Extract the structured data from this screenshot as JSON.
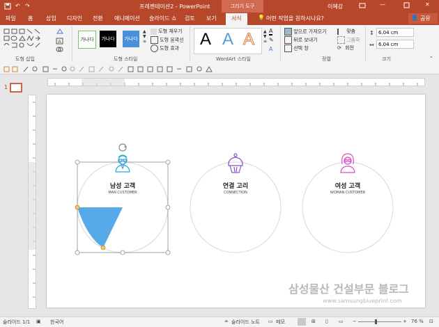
{
  "titlebar": {
    "title": "프레젠테이션2 - PowerPoint",
    "context_tool": "그리기 도구",
    "user_name": "이혜강"
  },
  "tabs": [
    "파일",
    "홈",
    "삽입",
    "디자인",
    "전환",
    "애니메이션",
    "슬라이드 쇼",
    "검토",
    "보기",
    "서식"
  ],
  "tell_me": "어떤 작업을 원하시나요?",
  "share": "공유",
  "ribbon": {
    "insert_shapes": "도형 삽입",
    "shape_styles": "도형 스타일",
    "quick_styles": [
      "가나다",
      "가나다",
      "가나다"
    ],
    "shape_fill": "도형 채우기",
    "shape_outline": "도형 윤곽선",
    "shape_effects": "도형 효과",
    "wordart": "WordArt 스타일",
    "wordart_letter": "A",
    "arrange": "정렬",
    "bring_forward": "앞으로 가져오기",
    "send_backward": "뒤로 보내기",
    "selection_pane": "선택 창",
    "align": "맞춤",
    "group": "그룹화",
    "rotate": "회전",
    "size": "크기",
    "height": "6.04 cm",
    "width": "6.04 cm"
  },
  "slide_thumb_number": "1",
  "slide": {
    "items": [
      {
        "title": "남성 고객",
        "subtitle": "MAN CUSTOMER"
      },
      {
        "title": "연결 고리",
        "subtitle": "CONNECTION"
      },
      {
        "title": "여성 고객",
        "subtitle": "WOMAN CUSTOMER"
      }
    ]
  },
  "status": {
    "slide_info": "슬라이드 1/1",
    "language": "한국어",
    "notes": "슬라이드 노트",
    "comments": "메모",
    "zoom": "76 %"
  },
  "watermark": {
    "title": "삼성물산 건설부문 블로그",
    "url": "www.samsungblueprint.com"
  },
  "colors": {
    "accent": "#b7472a",
    "wedge": "#56a9e8",
    "man_icon": "#2aa8d8",
    "cake_icon": "#8a4fc7",
    "woman_icon": "#d94ec2"
  }
}
